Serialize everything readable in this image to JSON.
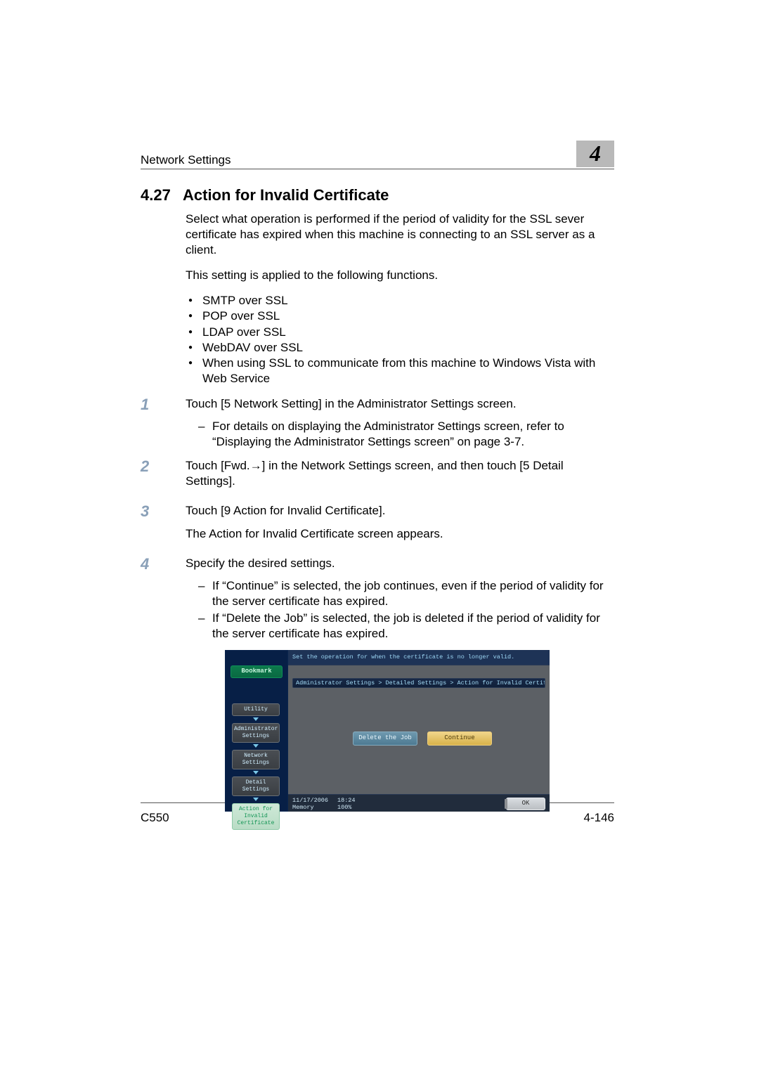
{
  "header": {
    "section": "Network Settings",
    "chapter": "4"
  },
  "title": {
    "num": "4.27",
    "text": "Action for Invalid Certificate"
  },
  "intro": {
    "p1": "Select what operation is performed if the period of validity for the SSL sever certificate has expired when this machine is connecting to an SSL server as a client.",
    "p2": "This setting is applied to the following functions."
  },
  "bullets": [
    "SMTP over SSL",
    "POP over SSL",
    "LDAP over SSL",
    "WebDAV over SSL",
    "When using SSL to communicate from this machine to Windows Vista with Web Service"
  ],
  "steps": [
    {
      "n": "1",
      "main": "Touch [5 Network Setting] in the Administrator Settings screen.",
      "subs": [
        "For details on displaying the Administrator Settings screen, refer to “Displaying the Administrator Settings screen” on page 3-7."
      ]
    },
    {
      "n": "2",
      "main": "Touch [Fwd.→] in the Network Settings screen, and then touch [5 Detail Settings].",
      "subs": []
    },
    {
      "n": "3",
      "main": "Touch [9 Action for Invalid Certificate].",
      "after": "The Action for Invalid Certificate screen appears.",
      "subs": []
    },
    {
      "n": "4",
      "main": "Specify the desired settings.",
      "subs": [
        "If “Continue” is selected, the job continues, even if the period of validity for the server certificate has expired.",
        "If “Delete the Job” is selected, the job is deleted if the period of validity for the server certificate has expired."
      ]
    }
  ],
  "ui": {
    "bookmark": "Bookmark",
    "hint": "Set the operation for when the certificate is no longer valid.",
    "breadcrumb": "Administrator Settings > Detailed Settings > Action for Invalid Certificate",
    "crumbs": [
      "Utility",
      "Administrator Settings",
      "Network Settings",
      "Detail Settings",
      "Action for Invalid Certificate"
    ],
    "buttons": {
      "delete": "Delete the Job",
      "cont": "Continue",
      "ok": "OK"
    },
    "status": {
      "date": "11/17/2006",
      "time": "18:24",
      "memLabel": "Memory",
      "memVal": "100%"
    }
  },
  "footer": {
    "model": "C550",
    "page": "4-146"
  }
}
